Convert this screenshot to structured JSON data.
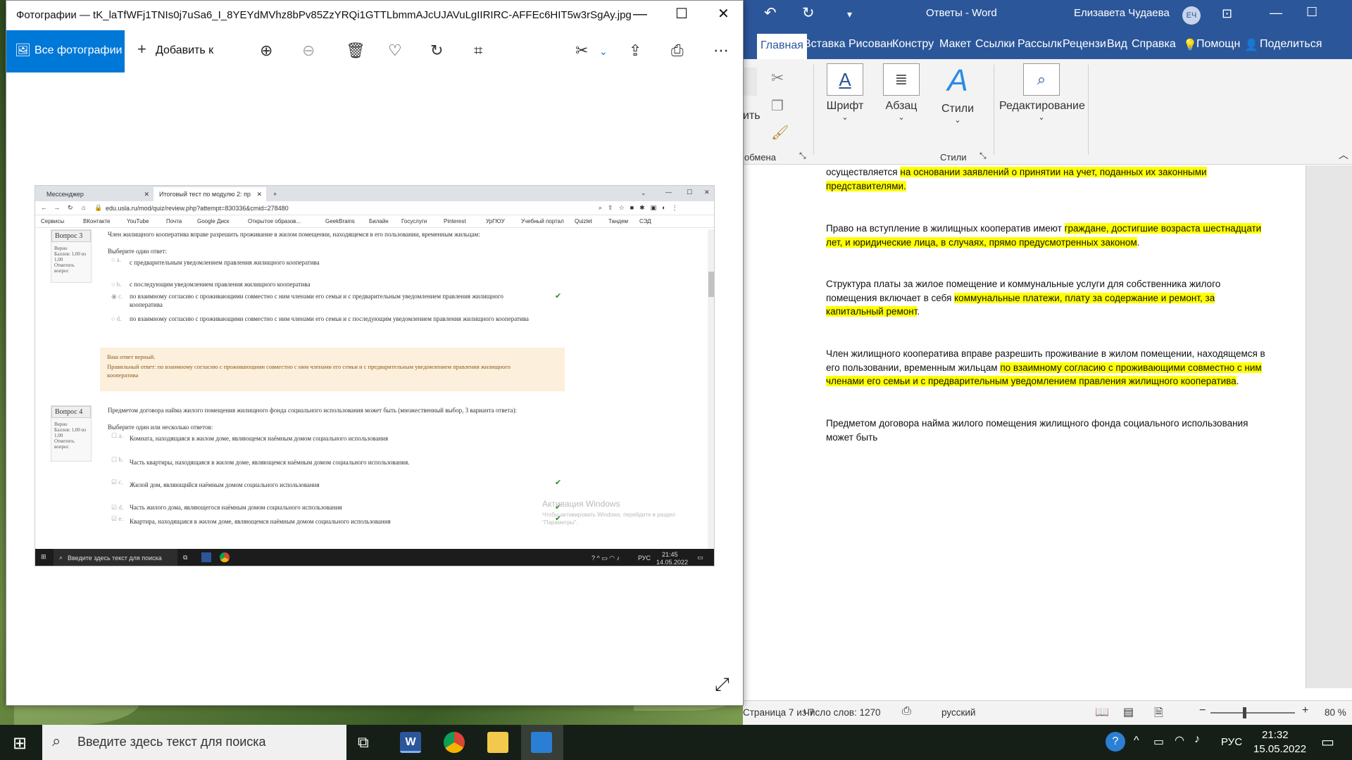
{
  "photos": {
    "title": "Фотографии — tK_laTfWFj1TNIs0j7uSa6_I_8YEYdMVhz8bPv85ZzYRQi1GTTLbmmAJcUJAVuLgIIRIRC-AFFEc6HIT5w3rSgAy.jpg",
    "all_photos": "Все фотографии",
    "add_to": "Добавить к"
  },
  "browser": {
    "tab1": "Мессенджер",
    "tab2": "Итоговый тест по модулю 2: пр",
    "url": "edu.usla.ru/mod/quiz/review.php?attempt=830336&cmid=278480",
    "bookmarks": [
      "Сервисы",
      "ВКонтакте",
      "YouTube",
      "Почта",
      "Google Диск",
      "Открытое образов...",
      "GeekBrains",
      "Билайн",
      "Госуслуги",
      "Pinterest",
      "УрГЮУ",
      "Учебный портал",
      "Quizlet",
      "Тандем",
      "СЭД"
    ]
  },
  "quiz": {
    "q3": {
      "label": "Вопрос 3",
      "meta1": "Верно",
      "meta2": "Баллов: 1,00 из 1,00",
      "meta3": "Отметить вопрос",
      "text": "Член жилищного кооператива вправе разрешить проживание в жилом помещении, находящемся в его пользовании, временным жильцам:",
      "prompt": "Выберите один ответ:",
      "a": "с предварительным уведомлением правления жилищного кооператива",
      "b": "с последующим уведомлением правления жилищного кооператива",
      "c": "по взаимному согласию с проживающими совместно с ним членами его семьи и с предварительным уведомлением правления жилищного",
      "c2": "кооператива",
      "d": "по взаимному согласию с проживающими совместно с ним членами его семьи и с последующим уведомлением правления жилищного кооператива",
      "fb1": "Ваш ответ верный.",
      "fb2": "Правильный ответ: по взаимному согласию с проживающими совместно с ним членами его семьи и с предварительным уведомлением правления жилищного",
      "fb3": "кооператива"
    },
    "q4": {
      "label": "Вопрос 4",
      "meta1": "Верно",
      "meta2": "Баллов: 1,00 из 1,00",
      "meta3": "Отметить вопрос",
      "text": "Предметом договора найма жилого помещения жилищного фонда социального использования может быть (множественный выбор, 3 варианта ответа):",
      "prompt": "Выберите один или несколько ответов:",
      "a": "Комната, находящаяся в жилом доме, являющемся наёмным домом социального использования",
      "b": "Часть квартиры, находящаяся в жилом доме, являющемся наёмным домом социального использования.",
      "c": "Жилой дом, являющийся наёмным домом социального использования",
      "d": "Часть жилого дома, являющегося наёмным домом социального использования",
      "e": "Квартира, находящаяся в жилом доме, являющемся наёмным домом социального использования"
    },
    "watermark1": "Активация Windows",
    "watermark2": "Чтобы активировать Windows, перейдите в раздел \"Параметры\".",
    "inner_search": "Введите здесь текст для поиска",
    "inner_lang": "РУС",
    "inner_time": "21:45",
    "inner_date": "14.05.2022"
  },
  "word": {
    "app": "Ответы - Word",
    "user": "Елизавета Чудаева",
    "initials": "ЕЧ",
    "tabs": [
      "Главная",
      "Вставка",
      "Рисован",
      "Констру",
      "Макет",
      "Ссылки",
      "Рассылк",
      "Рецензи",
      "Вид",
      "Справка"
    ],
    "help": "Помощн",
    "share": "Поделиться",
    "paste_partial": "ить",
    "clipboard": "обмена",
    "font": "Шрифт",
    "paragraph": "Абзац",
    "styles": "Стили",
    "styles_group": "Стили",
    "editing": "Редактирование",
    "p1a": "осуществляется ",
    "p1b": "на основании заявлений о принятии на учет, поданных их законными представителями.",
    "p2a": "Право на вступление в жилищных кооператив имеют ",
    "p2b": "граждане, достигшие возраста шестнадцати лет, и юридические лица, в случаях, прямо предусмотренных законом",
    "p2c": ".",
    "p3a": "Структура платы за жилое помещение и коммунальные услуги для собственника жилого помещения включает в себя ",
    "p3b": "коммунальные платежи, плату за содержание и ремонт, за капитальный ремонт",
    "p3c": ".",
    "p4a": "Член жилищного кооператива вправе разрешить проживание в жилом помещении, находящемся в его пользовании, временным жильцам ",
    "p4b": "по взаимному согласию с проживающими совместно с ним членами его семьи и с предварительным уведомлением правления жилищного кооператива",
    "p4c": ".",
    "p5": "Предметом договора найма жилого помещения жилищного фонда социального использования может быть",
    "page": "Страница 7 из 7",
    "words": "Число слов: 1270",
    "lang": "русский",
    "zoom": "80 %"
  },
  "taskbar": {
    "search": "Введите здесь текст для поиска",
    "lang": "РУС",
    "time": "21:32",
    "date": "15.05.2022"
  }
}
